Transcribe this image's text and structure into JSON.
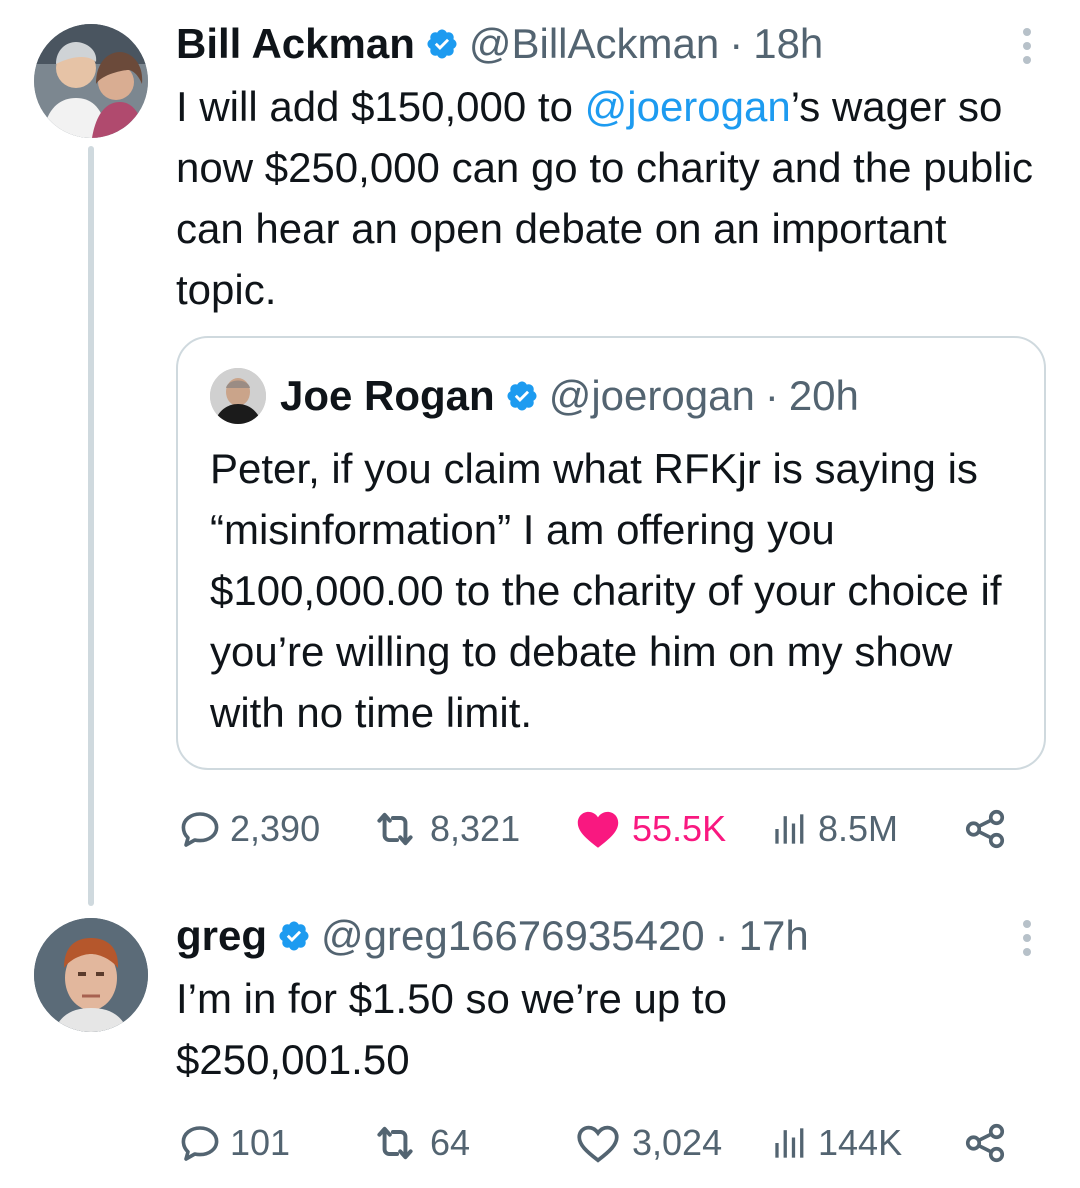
{
  "colors": {
    "text_primary": "#0f1419",
    "text_secondary": "#536471",
    "link": "#1d9bf0",
    "verified": "#1d9bf0",
    "like_active": "#f91880",
    "border": "#cfd9de"
  },
  "tweets": [
    {
      "author": {
        "name": "Bill Ackman",
        "handle": "@BillAckman",
        "avatar_icon": "user-avatar-photo",
        "verified_icon": "verified-badge-icon"
      },
      "separator": "·",
      "time": "18h",
      "text": {
        "prefix": "I will add $150,000 to ",
        "mention": "@joerogan",
        "suffix": "’s wager so now $250,000 can go to charity and the public can hear an open debate on an important topic."
      },
      "quote": {
        "author": {
          "name": "Joe Rogan",
          "handle": "@joerogan",
          "avatar_icon": "user-avatar-photo"
        },
        "separator": "·",
        "time": "20h",
        "text": "Peter, if you claim what RFKjr is saying is “misinformation” I am offering you $100,000.00 to the charity of your choice if you’re willing to debate him on my show with no time limit."
      },
      "stats": {
        "replies": "2,390",
        "retweets": "8,321",
        "likes": "55.5K",
        "views": "8.5M",
        "liked": true
      }
    },
    {
      "author": {
        "name": "greg",
        "handle": "@greg16676935420",
        "avatar_icon": "user-avatar-photo",
        "verified_icon": "verified-badge-icon"
      },
      "separator": "·",
      "time": "17h",
      "text": "I’m in for $1.50 so we’re up to $250,001.50",
      "stats": {
        "replies": "101",
        "retweets": "64",
        "likes": "3,024",
        "views": "144K",
        "liked": false
      }
    }
  ]
}
